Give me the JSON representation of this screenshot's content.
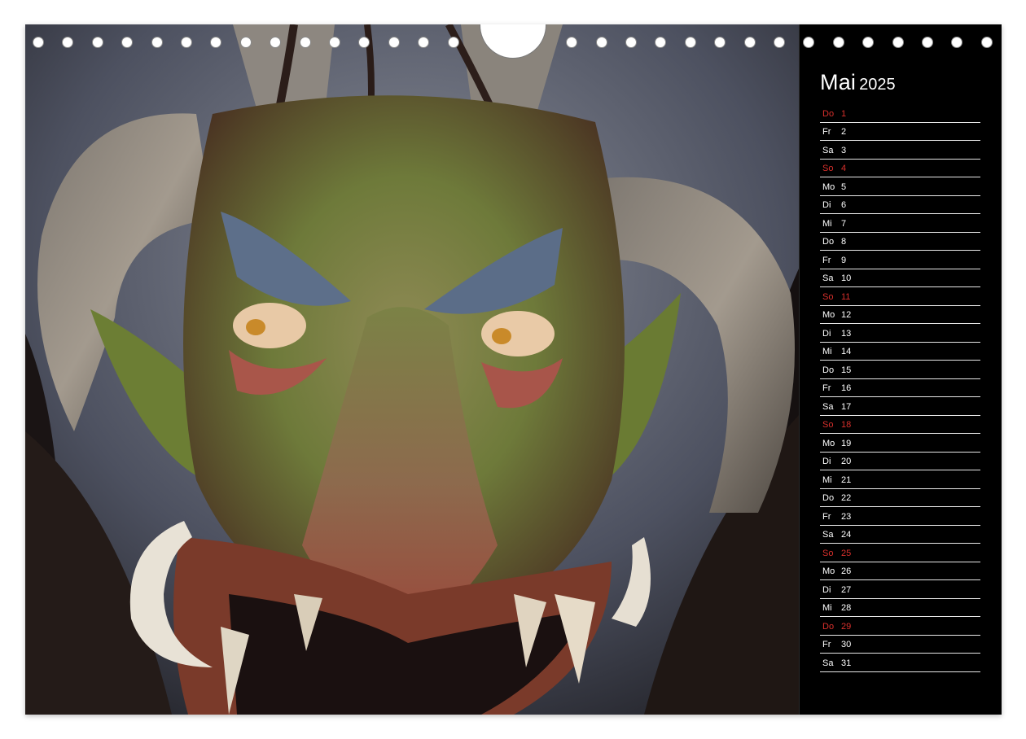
{
  "calendar": {
    "month": "Mai",
    "year": "2025",
    "days": [
      {
        "wd": "Do",
        "n": "1",
        "sun": true
      },
      {
        "wd": "Fr",
        "n": "2",
        "sun": false
      },
      {
        "wd": "Sa",
        "n": "3",
        "sun": false
      },
      {
        "wd": "So",
        "n": "4",
        "sun": true
      },
      {
        "wd": "Mo",
        "n": "5",
        "sun": false
      },
      {
        "wd": "Di",
        "n": "6",
        "sun": false
      },
      {
        "wd": "Mi",
        "n": "7",
        "sun": false
      },
      {
        "wd": "Do",
        "n": "8",
        "sun": false
      },
      {
        "wd": "Fr",
        "n": "9",
        "sun": false
      },
      {
        "wd": "Sa",
        "n": "10",
        "sun": false
      },
      {
        "wd": "So",
        "n": "11",
        "sun": true
      },
      {
        "wd": "Mo",
        "n": "12",
        "sun": false
      },
      {
        "wd": "Di",
        "n": "13",
        "sun": false
      },
      {
        "wd": "Mi",
        "n": "14",
        "sun": false
      },
      {
        "wd": "Do",
        "n": "15",
        "sun": false
      },
      {
        "wd": "Fr",
        "n": "16",
        "sun": false
      },
      {
        "wd": "Sa",
        "n": "17",
        "sun": false
      },
      {
        "wd": "So",
        "n": "18",
        "sun": true
      },
      {
        "wd": "Mo",
        "n": "19",
        "sun": false
      },
      {
        "wd": "Di",
        "n": "20",
        "sun": false
      },
      {
        "wd": "Mi",
        "n": "21",
        "sun": false
      },
      {
        "wd": "Do",
        "n": "22",
        "sun": false
      },
      {
        "wd": "Fr",
        "n": "23",
        "sun": false
      },
      {
        "wd": "Sa",
        "n": "24",
        "sun": false
      },
      {
        "wd": "So",
        "n": "25",
        "sun": true
      },
      {
        "wd": "Mo",
        "n": "26",
        "sun": false
      },
      {
        "wd": "Di",
        "n": "27",
        "sun": false
      },
      {
        "wd": "Mi",
        "n": "28",
        "sun": false
      },
      {
        "wd": "Do",
        "n": "29",
        "sun": true
      },
      {
        "wd": "Fr",
        "n": "30",
        "sun": false
      },
      {
        "wd": "Sa",
        "n": "31",
        "sun": false
      }
    ]
  },
  "colors": {
    "sunday_holiday": "#d9302c",
    "weekday": "#ffffff",
    "panel_background": "#000000"
  },
  "photo": {
    "icon": "krampus-mask-photo"
  }
}
